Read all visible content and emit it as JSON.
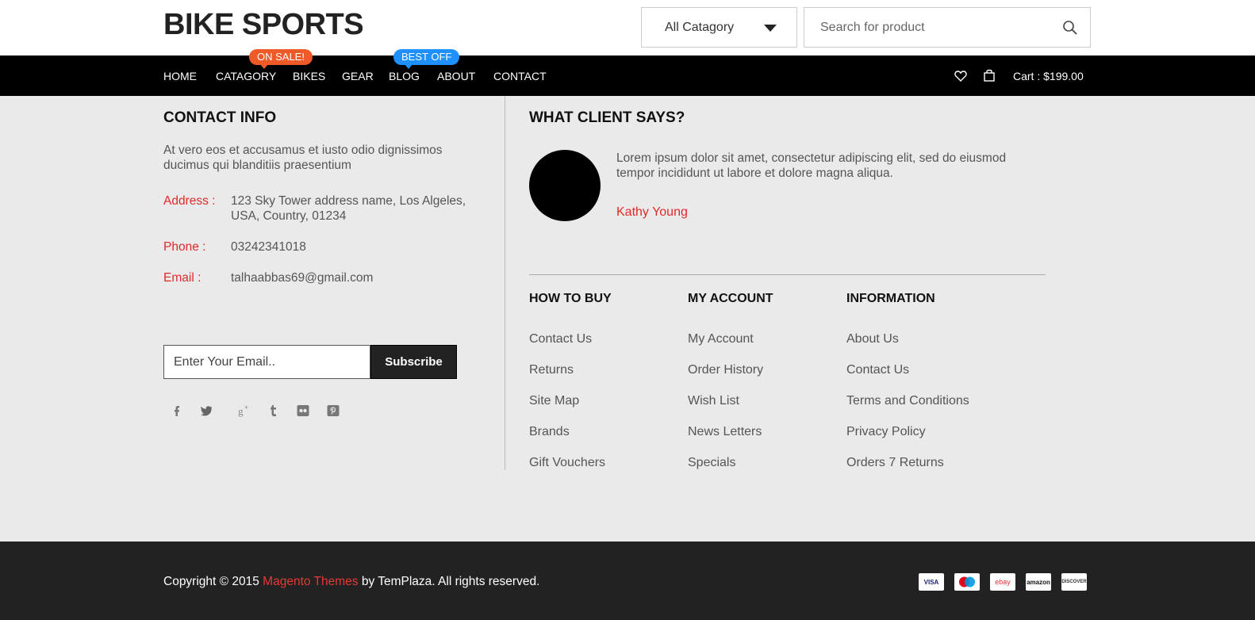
{
  "header": {
    "logo": "BIKE SPORTS",
    "category_select": "All Catagory",
    "search_placeholder": "Search for product"
  },
  "nav": {
    "items": [
      "HOME",
      "CATAGORY",
      "BIKES",
      "GEAR",
      "BLOG",
      "ABOUT",
      "CONTACT"
    ],
    "badges": {
      "sale": "ON SALE!",
      "best": "BEST OFF"
    },
    "cart": "Cart : $199.00"
  },
  "contact": {
    "title": "CONTACT INFO",
    "intro": "At vero eos et accusamus et iusto odio dignissimos ducimus qui blanditiis praesentium",
    "address_label": "Address :",
    "address": "123 Sky Tower address name, Los Algeles, USA, Country, 01234",
    "phone_label": "Phone :",
    "phone": "03242341018",
    "email_label": "Email :",
    "email": "talhaabbas69@gmail.com",
    "email_placeholder": "Enter Your Email..",
    "subscribe": "Subscribe",
    "social_icons": [
      "facebook-icon",
      "twitter-icon",
      "google-plus-icon",
      "tumblr-icon",
      "flickr-icon",
      "pinterest-icon"
    ]
  },
  "testimonial": {
    "title": "WHAT CLIENT SAYS?",
    "quote": "Lorem ipsum dolor sit amet, consectetur adipiscing elit, sed do eiusmod tempor incididunt ut labore et dolore magna aliqua.",
    "author": "Kathy Young"
  },
  "columns": {
    "how_to_buy": {
      "title": "HOW TO BUY",
      "links": [
        "Contact Us",
        "Returns",
        "Site Map",
        "Brands",
        "Gift Vouchers"
      ]
    },
    "my_account": {
      "title": "MY ACCOUNT",
      "links": [
        "My Account",
        "Order History",
        "Wish List",
        "News Letters",
        "Specials"
      ]
    },
    "information": {
      "title": "INFORMATION",
      "links": [
        "About Us",
        "Contact Us",
        "Terms and Conditions",
        "Privacy Policy",
        "Orders 7 Returns"
      ]
    }
  },
  "footer": {
    "copyright_pre": "Copyright © 2015 ",
    "copyright_link": "Magento Themes",
    "copyright_post": " by TemPlaza. All rights reserved.",
    "payments": [
      "VISA",
      "maestro",
      "ebay",
      "amazon",
      "DISCOVER"
    ]
  },
  "colors": {
    "accent_red": "#e02a2a",
    "sale_badge": "#f05a28",
    "best_badge": "#1e90ff",
    "nav_bg": "#000000",
    "footer_bg": "#222222",
    "page_bg": "#eaeaea"
  }
}
